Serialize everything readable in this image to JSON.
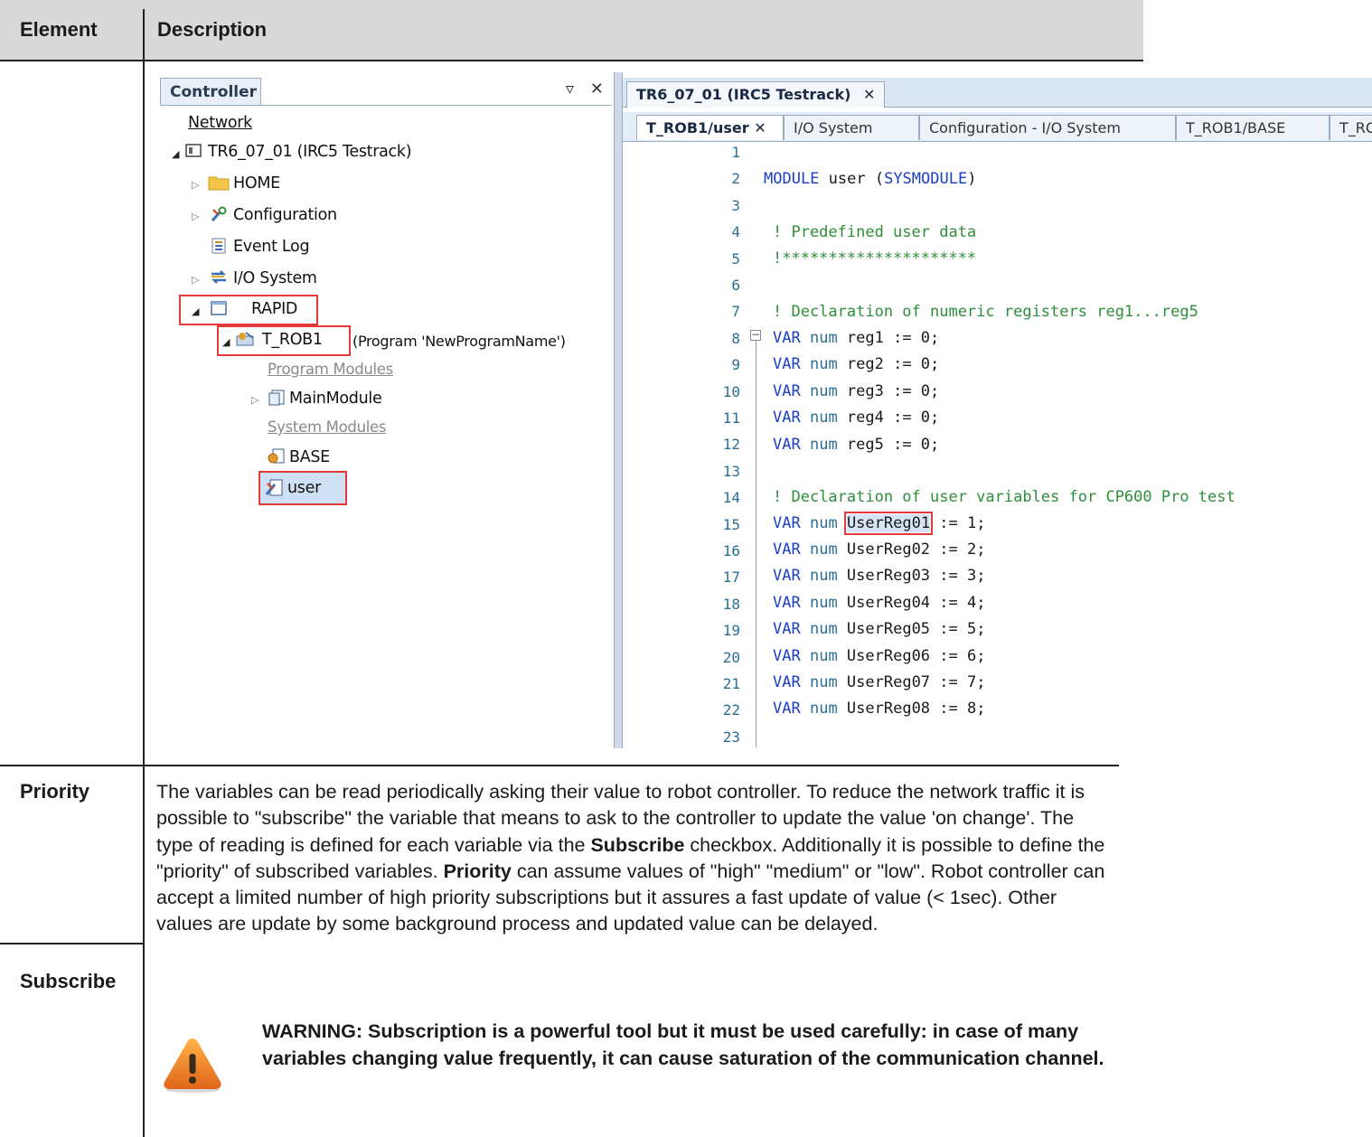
{
  "table": {
    "col_element": "Element",
    "col_description": "Description",
    "rows": [
      {
        "label": "Priority"
      },
      {
        "label": "Subscribe"
      }
    ]
  },
  "description": {
    "p1": "The variables can be read periodically asking their value to robot controller. To reduce the network traffic it is possible to \"subscribe\" the variable that means to ask to the controller to update the value 'on change'. The type of reading is defined for each variable via the ",
    "p1_bold": "Subscribe",
    "p2": " checkbox. Additionally it is possible to define the \"priority\" of subscribed variables. ",
    "p2_bold": "Priority",
    "p3": " can assume values of \"high\" \"medium\" or \"low\". Robot controller can accept a limited number of high priority subscriptions but it assures a fast update of value (< 1sec). Other values are update by some background process and updated value can be delayed.",
    "warning": "WARNING: Subscription is a powerful tool but it must be used carefully: in case of many variables changing value frequently, it can cause saturation of the communication channel."
  },
  "controller_panel": {
    "tab": "Controller",
    "buttons": "▿ ✕",
    "tree": [
      {
        "label": "Network"
      },
      {
        "label": "TR6_07_01 (IRC5 Testrack)"
      },
      {
        "label": "HOME"
      },
      {
        "label": "Configuration"
      },
      {
        "label": "Event Log"
      },
      {
        "label": "I/O System"
      },
      {
        "label": "RAPID"
      },
      {
        "label": "T_ROB1"
      },
      {
        "label": "(Program 'NewProgramName')"
      },
      {
        "label": "Program Modules"
      },
      {
        "label": "MainModule"
      },
      {
        "label": "System Modules"
      },
      {
        "label": "BASE"
      },
      {
        "label": "user"
      }
    ]
  },
  "editor": {
    "doc_tab": "TR6_07_01 (IRC5 Testrack)",
    "doc_tab_close": "✕",
    "subtabs": [
      {
        "label": "T_ROB1/user ✕"
      },
      {
        "label": "I/O System"
      },
      {
        "label": "Configuration - I/O System"
      },
      {
        "label": "T_ROB1/BASE"
      },
      {
        "label": "T_RO"
      }
    ],
    "line_numbers": [
      "1",
      "2",
      "3",
      "4",
      "5",
      "6",
      "7",
      "8",
      "9",
      "10",
      "11",
      "12",
      "13",
      "14",
      "15",
      "16",
      "17",
      "18",
      "19",
      "20",
      "21",
      "22",
      "23"
    ],
    "code": {
      "l2_kw": "MODULE",
      "l2_id": " user (",
      "l2_ty": "SYSMODULE",
      "l2_end": ")",
      "l4": "! Predefined user data",
      "l5": "!*********************",
      "l7": "! Declaration of numeric registers reg1...reg5",
      "l14": "! Declaration of user variables for CP600 Pro test",
      "var": "VAR",
      "num": "num",
      "regs": [
        " reg1 := 0;",
        " reg2 := 0;",
        " reg3 := 0;",
        " reg4 := 0;",
        " reg5 := 0;"
      ],
      "user_selected": "UserReg01",
      "user_first_rest": " := 1;",
      "users": [
        " UserReg02 := 2;",
        " UserReg03 := 3;",
        " UserReg04 := 4;",
        " UserReg05 := 5;",
        " UserReg06 := 6;",
        " UserReg07 := 7;",
        " UserReg08 := 8;"
      ]
    }
  }
}
